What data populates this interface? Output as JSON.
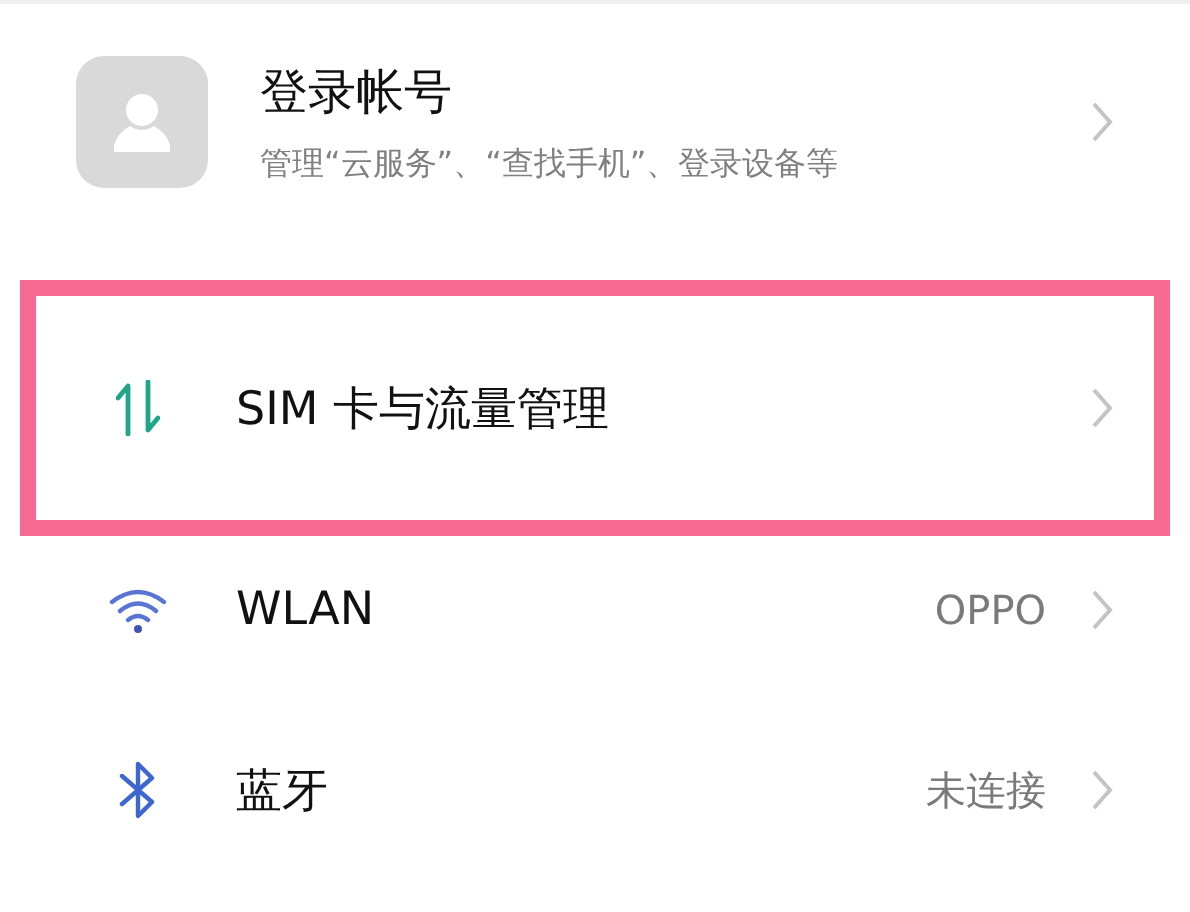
{
  "account": {
    "title": "登录帐号",
    "subtitle": "管理“云服务”、“查找手机”、登录设备等"
  },
  "items": [
    {
      "kind": "sim",
      "label": "SIM 卡与流量管理",
      "highlighted": true
    },
    {
      "kind": "wifi",
      "label": "WLAN",
      "value": "OPPO",
      "highlighted": false
    },
    {
      "kind": "bluetooth",
      "label": "蓝牙",
      "value": "未连接",
      "highlighted": false
    }
  ]
}
